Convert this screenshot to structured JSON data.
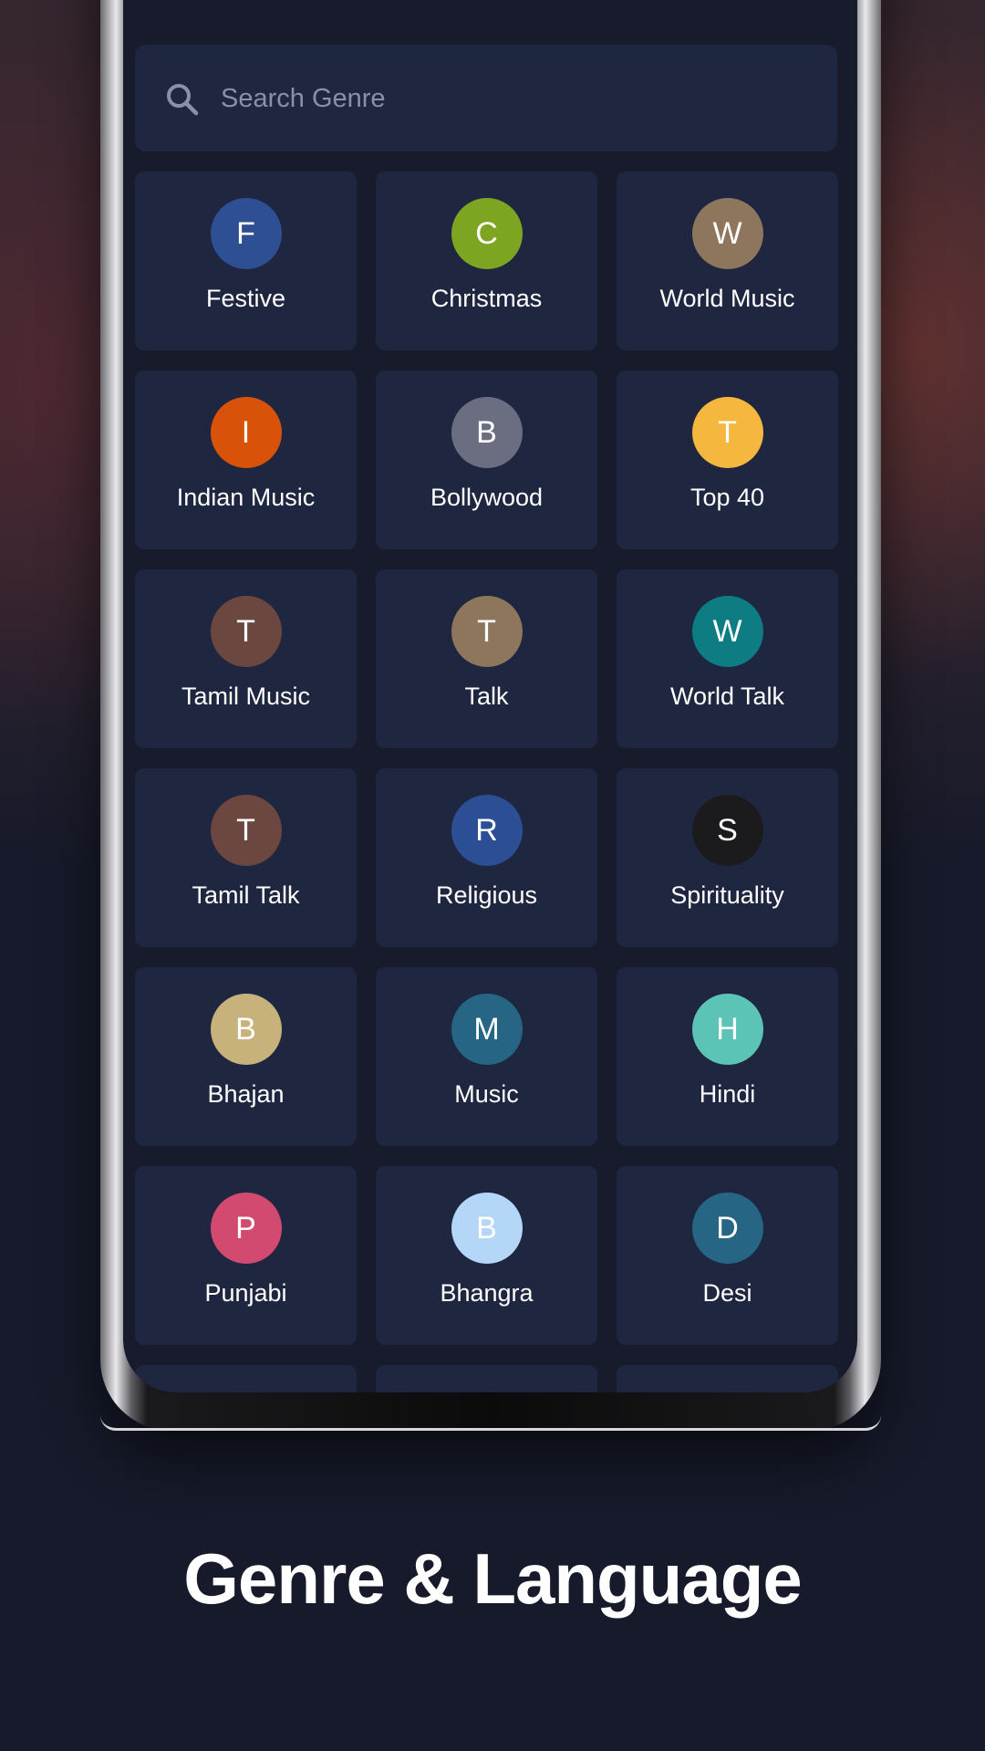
{
  "search": {
    "placeholder": "Search Genre",
    "icon": "search-icon"
  },
  "genres": [
    {
      "letter": "F",
      "label": "Festive",
      "color": "#2f4f94"
    },
    {
      "letter": "C",
      "label": "Christmas",
      "color": "#7ea522"
    },
    {
      "letter": "W",
      "label": "World Music",
      "color": "#8d765c"
    },
    {
      "letter": "I",
      "label": "Indian Music",
      "color": "#d9520a"
    },
    {
      "letter": "B",
      "label": "Bollywood",
      "color": "#6b6e80"
    },
    {
      "letter": "T",
      "label": "Top 40",
      "color": "#f5b73d"
    },
    {
      "letter": "T",
      "label": "Tamil Music",
      "color": "#6b4740"
    },
    {
      "letter": "T",
      "label": "Talk",
      "color": "#8d765c"
    },
    {
      "letter": "W",
      "label": "World Talk",
      "color": "#0e7d83"
    },
    {
      "letter": "T",
      "label": "Tamil Talk",
      "color": "#6b4740"
    },
    {
      "letter": "R",
      "label": "Religious",
      "color": "#2b4e94"
    },
    {
      "letter": "S",
      "label": "Spirituality",
      "color": "#1b1b1d"
    },
    {
      "letter": "B",
      "label": "Bhajan",
      "color": "#c8b27c"
    },
    {
      "letter": "M",
      "label": "Music",
      "color": "#266584"
    },
    {
      "letter": "H",
      "label": "Hindi",
      "color": "#5cc3b7"
    },
    {
      "letter": "P",
      "label": "Punjabi",
      "color": "#d34a70"
    },
    {
      "letter": "B",
      "label": "Bhangra",
      "color": "#b4d6f7"
    },
    {
      "letter": "D",
      "label": "Desi",
      "color": "#266584"
    }
  ],
  "caption": "Genre & Language"
}
